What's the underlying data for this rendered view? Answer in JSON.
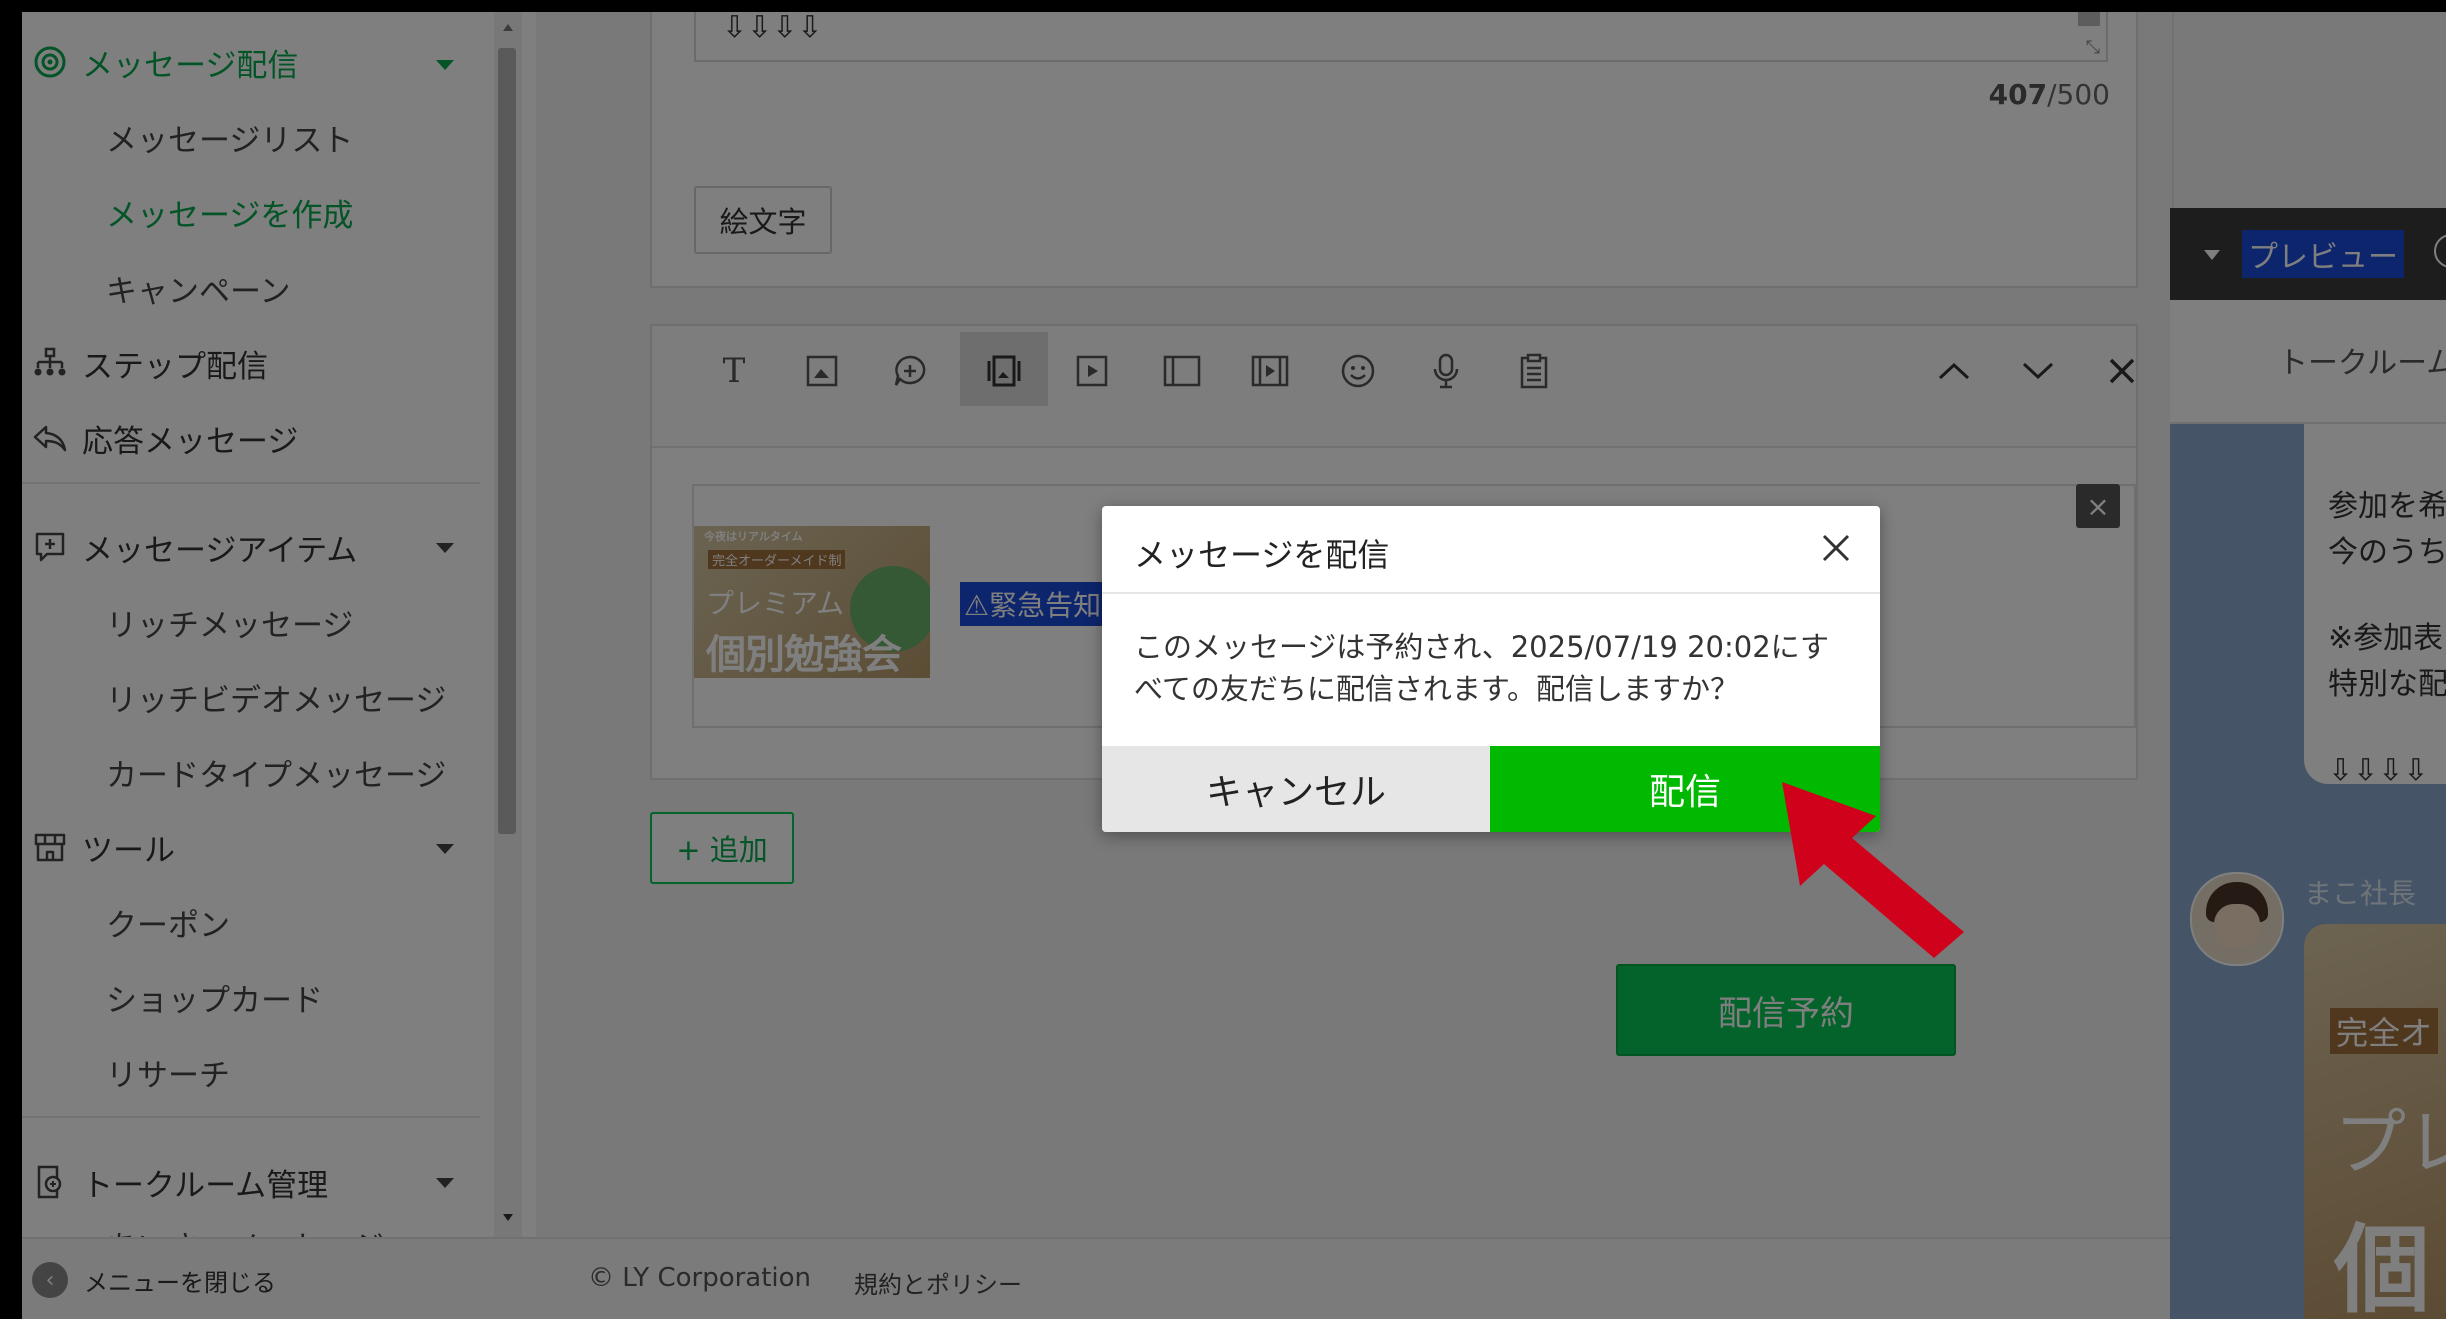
{
  "sidebar": {
    "message_delivery": "メッセージ配信",
    "message_list": "メッセージリスト",
    "create_message": "メッセージを作成",
    "campaign": "キャンペーン",
    "step_delivery": "ステップ配信",
    "auto_response": "応答メッセージ",
    "message_items": "メッセージアイテム",
    "rich_message": "リッチメッセージ",
    "rich_video_message": "リッチビデオメッセージ",
    "card_type_message": "カードタイプメッセージ",
    "tools": "ツール",
    "coupon": "クーポン",
    "shop_card": "ショップカード",
    "research": "リサーチ",
    "talk_room": "トークルーム管理",
    "greeting_partial": "あいさつメッセージ",
    "close_menu": "メニューを閉じる"
  },
  "editor": {
    "arrows_text": "⇩⇩⇩⇩",
    "char_count": "407",
    "char_limit": "/500",
    "emoji_button": "絵文字",
    "image_banner_top": "今夜はリアルタイム",
    "image_banner_sub": "完全オーダーメイド制",
    "image_premium": "プレミアム",
    "image_title": "個別勉強会",
    "urgent_tag": "⚠緊急告知",
    "add_button": "+ 追加",
    "schedule_button": "配信予約"
  },
  "preview": {
    "header": "プレビュー",
    "tab_talkroom": "トークルーム",
    "bubble_line1": "参加を希",
    "bubble_line2": "今のうち",
    "bubble_line3": "※参加表",
    "bubble_line4": "特別な配",
    "bubble_arrows": "⇩⇩⇩⇩",
    "sender_name": "まこ社長",
    "image_line1": "完全オ",
    "image_line2": "プレ",
    "image_line3": "個"
  },
  "footer": {
    "copyright": "© LY Corporation",
    "terms": "規約とポリシー"
  },
  "dialog": {
    "title": "メッセージを配信",
    "message_line1": "このメッセージは予約され、2025/07/19 20:02にす",
    "message_line2": "べての友だちに配信されます。配信しますか？",
    "cancel": "キャンセル",
    "confirm": "配信"
  },
  "colors": {
    "brand_green": "#06c755",
    "confirm_green": "#00b900",
    "arrow_red": "#d0021b"
  }
}
